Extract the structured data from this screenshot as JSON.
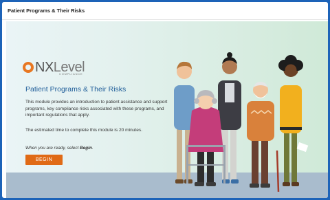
{
  "window": {
    "title": "Patient Programs & Their Risks"
  },
  "logo": {
    "brand_prefix": "NX",
    "brand_suffix": "Level",
    "tagline": "COMPLIANCE"
  },
  "module": {
    "title": "Patient Programs & Their Risks",
    "description": "This module provides an introduction to patient assistance and support programs, key compliance risks associated with these programs, and important regulations that apply.",
    "time_estimate": "The estimated time to complete this module is 20 minutes.",
    "ready_prefix": "When you are ready, select ",
    "ready_action": "Begin",
    "ready_suffix": "."
  },
  "actions": {
    "begin_label": "BEGIN"
  },
  "colors": {
    "brand_orange": "#e06a16",
    "title_blue": "#1f5d99",
    "frame_blue": "#1d63b8"
  }
}
